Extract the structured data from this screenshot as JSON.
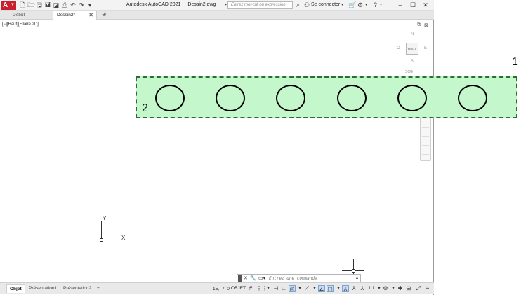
{
  "titlebar": {
    "app_letter": "A",
    "app_name": "Autodesk AutoCAD 2021",
    "file_name": "Dessin2.dwg",
    "search_placeholder": "Entrez mot-clé ou expression",
    "signin_label": "Se connecter",
    "help_label": "?"
  },
  "tabs": [
    {
      "label": "Début"
    },
    {
      "label": "Dessin2*"
    }
  ],
  "viewport": {
    "label": "[−][Haut][Filaire 2D]"
  },
  "viewcube": {
    "north": "N",
    "south": "S",
    "west": "O",
    "east": "E",
    "face": "HAUT",
    "scu": "SCG"
  },
  "drawing": {
    "callout_1": "1",
    "callout_2": "2",
    "circle_count": 6,
    "band_color": "#c4f7cc",
    "band_border_color": "#2f6b36"
  },
  "ucs": {
    "x_label": "X",
    "y_label": "Y"
  },
  "command": {
    "placeholder": "Entrez une commande"
  },
  "statusbar": {
    "layouts": [
      {
        "label": "Objet"
      },
      {
        "label": "Présentation1"
      },
      {
        "label": "Présentation2"
      }
    ],
    "add_label": "+",
    "coordinates": "15, -7, 0",
    "model_label": "OBJET"
  }
}
